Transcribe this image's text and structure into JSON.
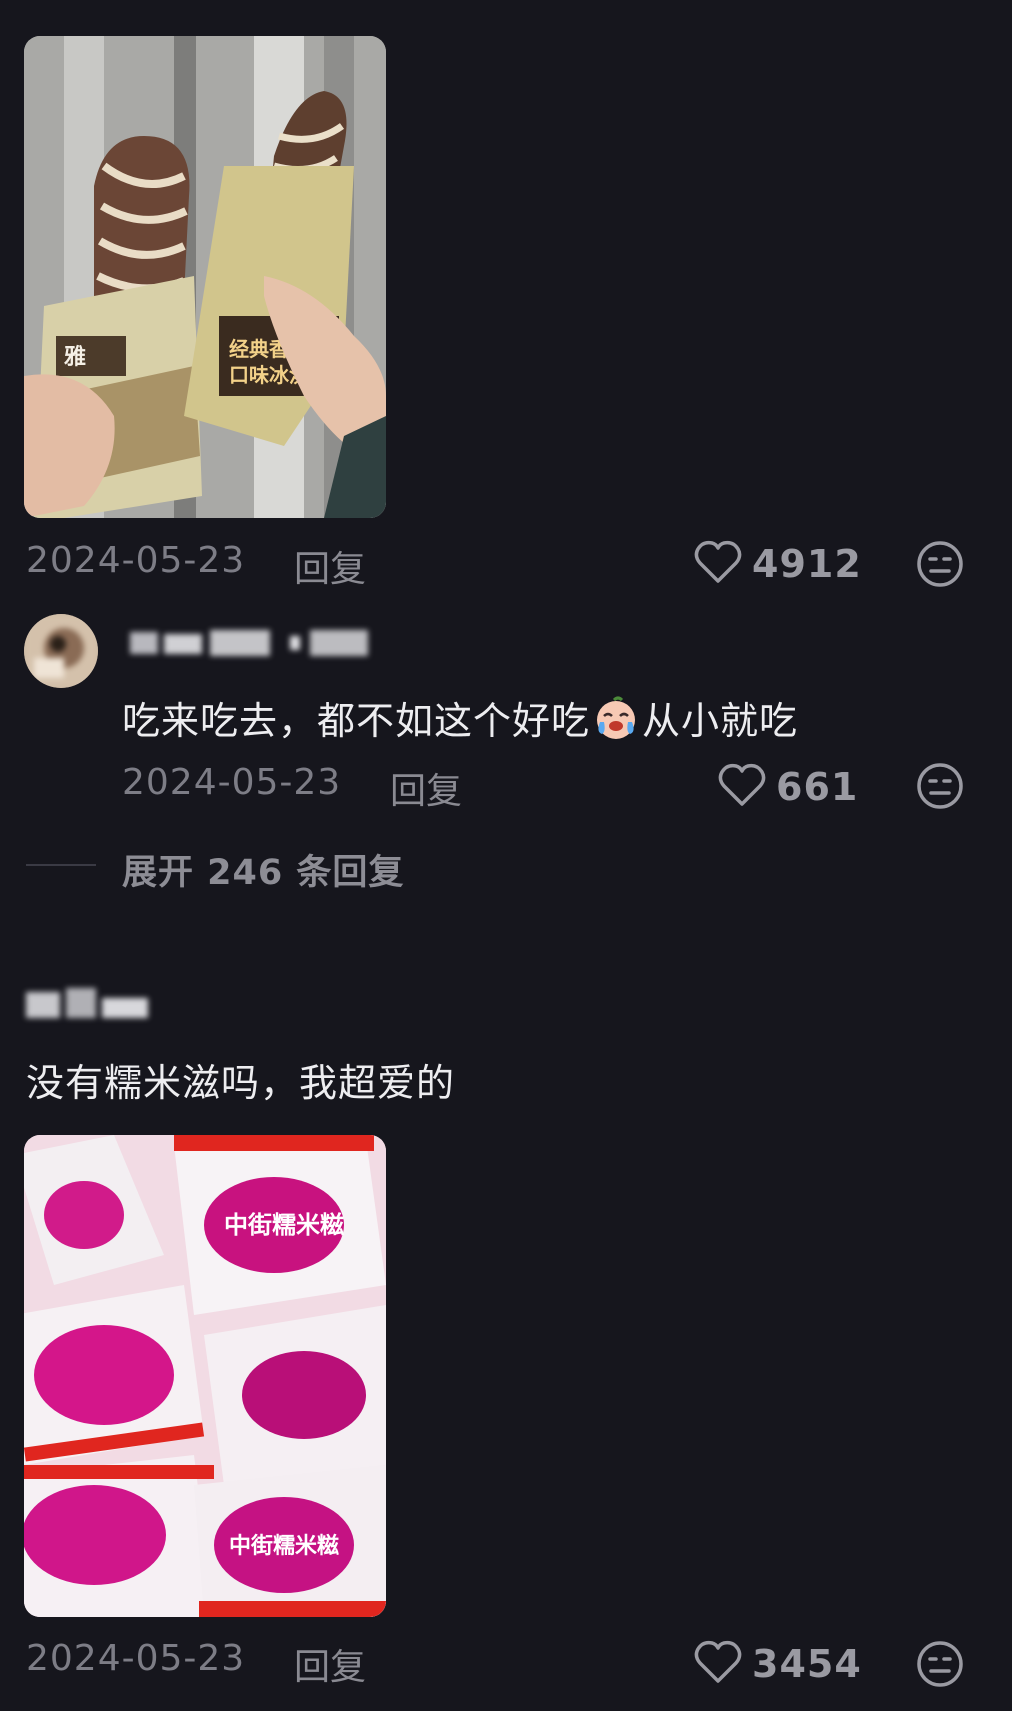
{
  "post1": {
    "photo_alt": "two ice cream bars held up",
    "date": "2024-05-23",
    "reply_label": "回复",
    "likes": "4912",
    "icons": {
      "like": "heart-outline-icon",
      "dislike": "meh-face-icon"
    }
  },
  "reply1": {
    "text": "吃来吃去，都不如这个好吃",
    "text_after_emoji": "从小就吃",
    "emoji": "crying-face-emoji",
    "date": "2024-05-23",
    "reply_label": "回复",
    "likes": "661"
  },
  "expand": {
    "label": "展开 246 条回复"
  },
  "post2": {
    "text": "没有糯米滋吗，我超爱的",
    "photo_alt": "pile of pink glutinous rice ice cream packs",
    "date": "2024-05-23",
    "reply_label": "回复",
    "likes": "3454"
  },
  "colors": {
    "background": "#16161d",
    "text_primary": "#ededf0",
    "text_secondary": "#7d7d86"
  }
}
